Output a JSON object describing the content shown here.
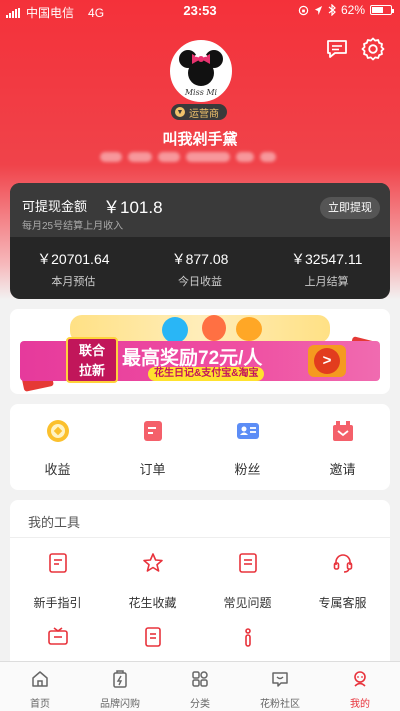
{
  "status_bar": {
    "carrier": "中国电信",
    "network": "4G",
    "time": "23:53",
    "battery": "62%",
    "battery_level": 0.62
  },
  "header": {
    "icons": [
      "message-icon",
      "settings-icon"
    ],
    "avatar_brand": "Miss Mi",
    "role_badge": "运营商",
    "username": "叫我剁手黛"
  },
  "earnings": {
    "withdrawable_label": "可提现金额",
    "withdrawable_amount": "￥101.8",
    "settle_note": "每月25号结算上月收入",
    "withdraw_button": "立即提现",
    "stats": [
      {
        "value": "￥20701.64",
        "label": "本月预估"
      },
      {
        "value": "￥877.08",
        "label": "今日收益"
      },
      {
        "value": "￥32547.11",
        "label": "上月结算"
      }
    ]
  },
  "banner": {
    "tag_line1": "联合",
    "tag_line2": "拉新",
    "headline": "最高奖励72元/人",
    "subline": "花生日记&支付宝&淘宝",
    "go": ">"
  },
  "quick_actions": [
    {
      "label": "收益",
      "icon": "coin-icon"
    },
    {
      "label": "订单",
      "icon": "order-icon"
    },
    {
      "label": "粉丝",
      "icon": "fans-icon"
    },
    {
      "label": "邀请",
      "icon": "invite-icon"
    }
  ],
  "tools": {
    "title": "我的工具",
    "items": [
      {
        "label": "新手指引",
        "icon": "guide-icon"
      },
      {
        "label": "花生收藏",
        "icon": "star-icon"
      },
      {
        "label": "常见问题",
        "icon": "faq-icon"
      },
      {
        "label": "专属客服",
        "icon": "headset-icon"
      },
      {
        "label": "",
        "icon": "tv-icon"
      },
      {
        "label": "",
        "icon": "note-icon"
      },
      {
        "label": "",
        "icon": "info-icon"
      }
    ]
  },
  "tabbar": {
    "items": [
      {
        "label": "首页",
        "icon": "home-icon"
      },
      {
        "label": "品牌闪购",
        "icon": "flash-sale-icon"
      },
      {
        "label": "分类",
        "icon": "category-icon"
      },
      {
        "label": "花粉社区",
        "icon": "community-icon"
      },
      {
        "label": "我的",
        "icon": "profile-icon"
      }
    ],
    "active": "我的"
  },
  "colors": {
    "brand_red": "#f4313a",
    "card_dark": "#262626",
    "active_tab": "#e8333c"
  }
}
